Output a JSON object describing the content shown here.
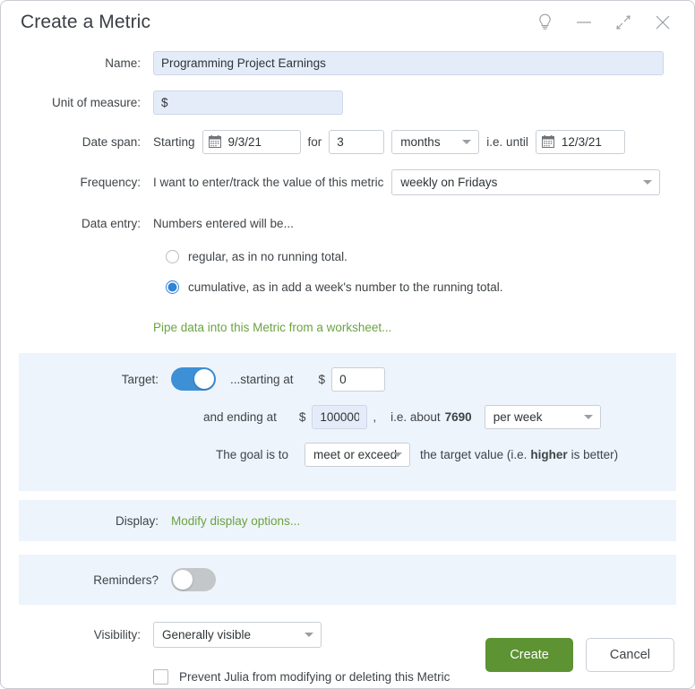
{
  "window": {
    "title": "Create a Metric",
    "icons": [
      {
        "name": "lightbulb-icon",
        "label": "tips"
      },
      {
        "name": "minimize-icon",
        "label": "minimize"
      },
      {
        "name": "collapse-icon",
        "label": "collapse"
      },
      {
        "name": "close-icon",
        "label": "close"
      }
    ]
  },
  "name_row": {
    "label": "Name:",
    "value": "Programming Project Earnings",
    "placeholder": "Programming Project Earnings"
  },
  "unit_row": {
    "label": "Unit of measure:",
    "value": "$",
    "placeholder": "$"
  },
  "date_span": {
    "label": "Date span:",
    "starting_text": "Starting",
    "start_date": "9/3/21",
    "for_text": "for",
    "duration": "3",
    "unit": "months",
    "until_text": "i.e. until",
    "end_date": "12/3/21",
    "calendar_icon": "calendar-icon"
  },
  "frequency": {
    "label": "Frequency:",
    "prefix": "I want to enter/track the value of this metric",
    "value": "weekly on Fridays"
  },
  "data_entry": {
    "label": "Data entry:",
    "intro": "Numbers entered will be...",
    "options": [
      {
        "label": "regular, as in no running total.",
        "selected": false
      },
      {
        "label": "cumulative, as in add a week's number to the running total.",
        "selected": true
      }
    ],
    "pipe_link": "Pipe data into this Metric from a worksheet..."
  },
  "target": {
    "label": "Target:",
    "enabled": true,
    "starting_text": "...starting at",
    "currency": "$",
    "start_value": "0",
    "ending_text": "and ending at",
    "end_currency": "$",
    "end_value": "100000",
    "comma": ",",
    "about_text": "i.e. about",
    "about_value": "7690",
    "per_period": "per week",
    "goal_prefix": "The goal is to",
    "goal_value": "meet or exceed",
    "goal_suffix_a": "the target value (i.e.",
    "goal_suffix_bold": "higher",
    "goal_suffix_b": "is better)"
  },
  "display": {
    "label": "Display:",
    "link": "Modify display options..."
  },
  "reminders": {
    "label": "Reminders?",
    "enabled": false
  },
  "visibility": {
    "label": "Visibility:",
    "value": "Generally visible",
    "prevent_label": "Prevent Julia from modifying or deleting this Metric",
    "prevent_checked": false
  },
  "footer": {
    "create_label": "Create",
    "cancel_label": "Cancel"
  },
  "colors": {
    "accent_blue": "#3d8fd6",
    "link_green": "#6aa341",
    "create_green": "#5d9332",
    "band_blue": "#eef4fb",
    "input_blue": "#e5ecf9"
  }
}
